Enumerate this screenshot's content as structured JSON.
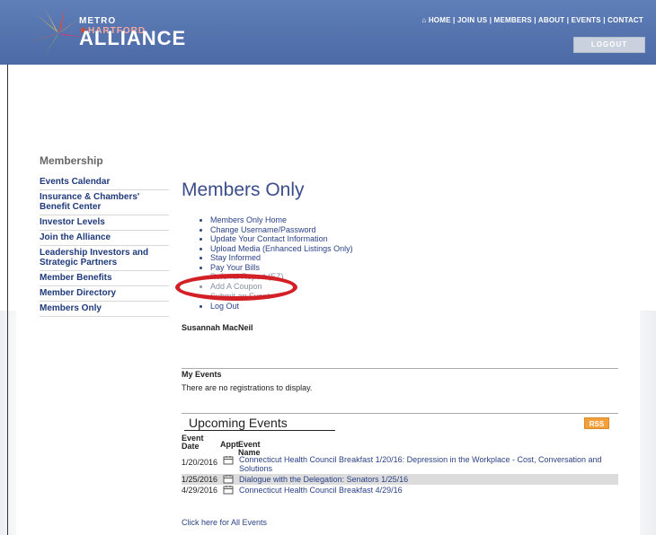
{
  "header": {
    "logo_top_metro": "METRO",
    "logo_top_star": "★",
    "logo_top_hartford": "HARTFORD",
    "logo_main": "ALLIANCE",
    "nav_text": "⌂ HOME | JOIN US | MEMBERS | ABOUT | EVENTS | CONTACT",
    "logout_label": "LOGOUT"
  },
  "sidebar": {
    "title": "Membership",
    "items": [
      {
        "label": "Events Calendar"
      },
      {
        "label": "Insurance & Chambers' Benefit Center"
      },
      {
        "label": "Investor Levels"
      },
      {
        "label": "Join the Alliance"
      },
      {
        "label": "Leadership Investors and Strategic Partners"
      },
      {
        "label": "Member Benefits"
      },
      {
        "label": "Member Directory"
      },
      {
        "label": "Members Only"
      }
    ]
  },
  "main": {
    "title": "Members Only",
    "menu": [
      "Members Only Home",
      "Change Username/Password",
      "Update Your Contact Information",
      "Upload Media (Enhanced Listings Only)",
      "Stay Informed",
      "Pay Your Bills",
      "Referral Report (EZ)",
      "Add A Coupon",
      "Submit an Event",
      "Log Out"
    ],
    "user_name": "Susannah MacNeil",
    "my_events_heading": "My Events",
    "my_events_empty": "There are no registrations to display.",
    "upcoming_title": "Upcoming Events",
    "rss_label": "RSS",
    "col_date": "Event Date",
    "col_appt": "Appt",
    "col_name": "Event Name",
    "events": [
      {
        "date": "1/20/2016",
        "name": "Connecticut Health Council Breakfast 1/20/16: Depression in the Workplace - Cost, Conversation and Solutions"
      },
      {
        "date": "1/25/2016",
        "name": "Dialogue with the Delegation: Senators 1/25/16"
      },
      {
        "date": "4/29/2016",
        "name": "Connecticut Health Council Breakfast 4/29/16"
      }
    ],
    "all_events_link": "Click here for All Events"
  },
  "colors": {
    "header_blue": "#5070aa",
    "link_blue": "#2b4287",
    "highlight_red": "#d32027",
    "rss_orange": "#f2a03b"
  }
}
